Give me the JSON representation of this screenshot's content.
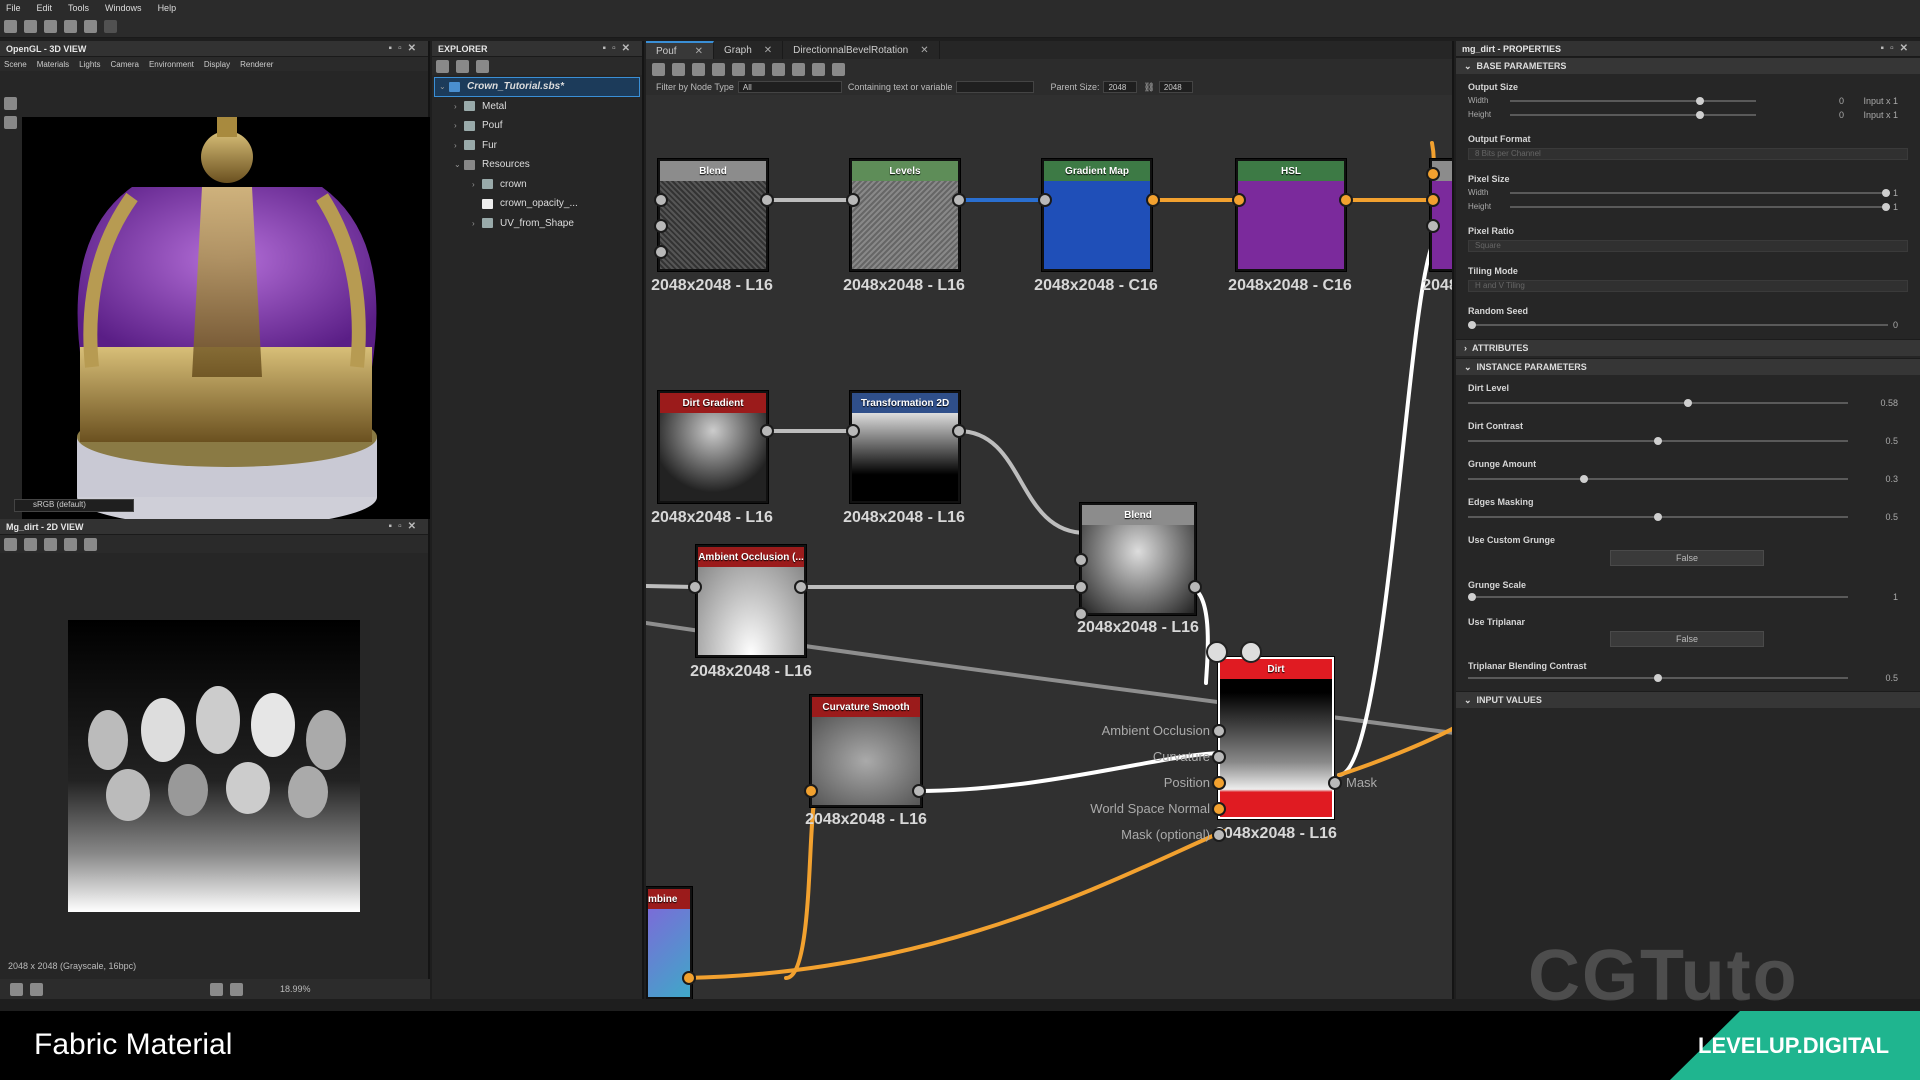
{
  "menu": [
    "File",
    "Edit",
    "Tools",
    "Windows",
    "Help"
  ],
  "view3d": {
    "title": "OpenGL - 3D VIEW",
    "menu": [
      "Scene",
      "Materials",
      "Lights",
      "Camera",
      "Environment",
      "Display",
      "Renderer"
    ],
    "colorspace": "sRGB (default)"
  },
  "view2d": {
    "title": "Mg_dirt - 2D VIEW",
    "info": "2048 x 2048 (Grayscale, 16bpc)",
    "zoom": "18.99%"
  },
  "explorer": {
    "title": "EXPLORER",
    "file": "Crown_Tutorial.sbs*",
    "items": [
      "Metal",
      "Pouf",
      "Fur",
      "Resources",
      "crown",
      "crown_opacity_...",
      "UV_from_Shape"
    ]
  },
  "graph": {
    "tabs": [
      "Pouf",
      "Graph",
      "DirectionnalBevelRotation"
    ],
    "filter_label": "Filter by Node Type",
    "filter_value": "All",
    "contain_label": "Containing text or variable",
    "parent_label": "Parent Size:",
    "parent_value": "2048",
    "parent_value2": "2048",
    "nodes": {
      "blend1": "Blend",
      "levels": "Levels",
      "gradient": "Gradient Map",
      "hsl": "HSL",
      "dirtgrad": "Dirt Gradient",
      "transform": "Transformation 2D",
      "ao": "Ambient Occlusion (...",
      "blend2": "Blend",
      "curv": "Curvature Smooth",
      "dirt": "Dirt",
      "combine": "mbine"
    },
    "res": {
      "l16": "2048x2048 - L16",
      "c16": "2048x2048 - C16",
      "cut": "2048"
    },
    "dirt_inputs": [
      "Ambient Occlusion",
      "Curvature",
      "Position",
      "World Space Normal",
      "Mask (optional)"
    ],
    "dirt_output": "Mask"
  },
  "props": {
    "title": "mg_dirt - PROPERTIES",
    "sections": {
      "base": "BASE PARAMETERS",
      "attr": "ATTRIBUTES",
      "inst": "INSTANCE PARAMETERS",
      "input": "INPUT VALUES"
    },
    "output_size": "Output Size",
    "width": "Width",
    "height": "Height",
    "zero": "0",
    "input_x1": "Input x 1",
    "output_format": "Output Format",
    "output_format_val": "8 Bits per Channel",
    "pixel_size": "Pixel Size",
    "one": "1",
    "pixel_ratio": "Pixel Ratio",
    "pixel_ratio_val": "Square",
    "tiling": "Tiling Mode",
    "tiling_val": "H and V Tiling",
    "seed": "Random Seed",
    "seed_val": "0",
    "params": [
      {
        "label": "Dirt Level",
        "value": "0.58",
        "pos": 0.58
      },
      {
        "label": "Dirt Contrast",
        "value": "0.5",
        "pos": 0.5
      },
      {
        "label": "Grunge Amount",
        "value": "0.3",
        "pos": 0.3
      },
      {
        "label": "Edges Masking",
        "value": "0.5",
        "pos": 0.5
      }
    ],
    "use_custom": "Use Custom Grunge",
    "false": "False",
    "grunge_scale": "Grunge Scale",
    "use_tri": "Use Triplanar",
    "tri_contrast": "Triplanar Blending Contrast"
  },
  "caption": "Fabric Material",
  "watermark": "CGTuto",
  "brand": "LEVELUP.DIGITAL",
  "colors": {
    "accent": "#3a8fd6",
    "wire_orange": "#f2a12f",
    "brand_teal": "#1fb58f"
  }
}
